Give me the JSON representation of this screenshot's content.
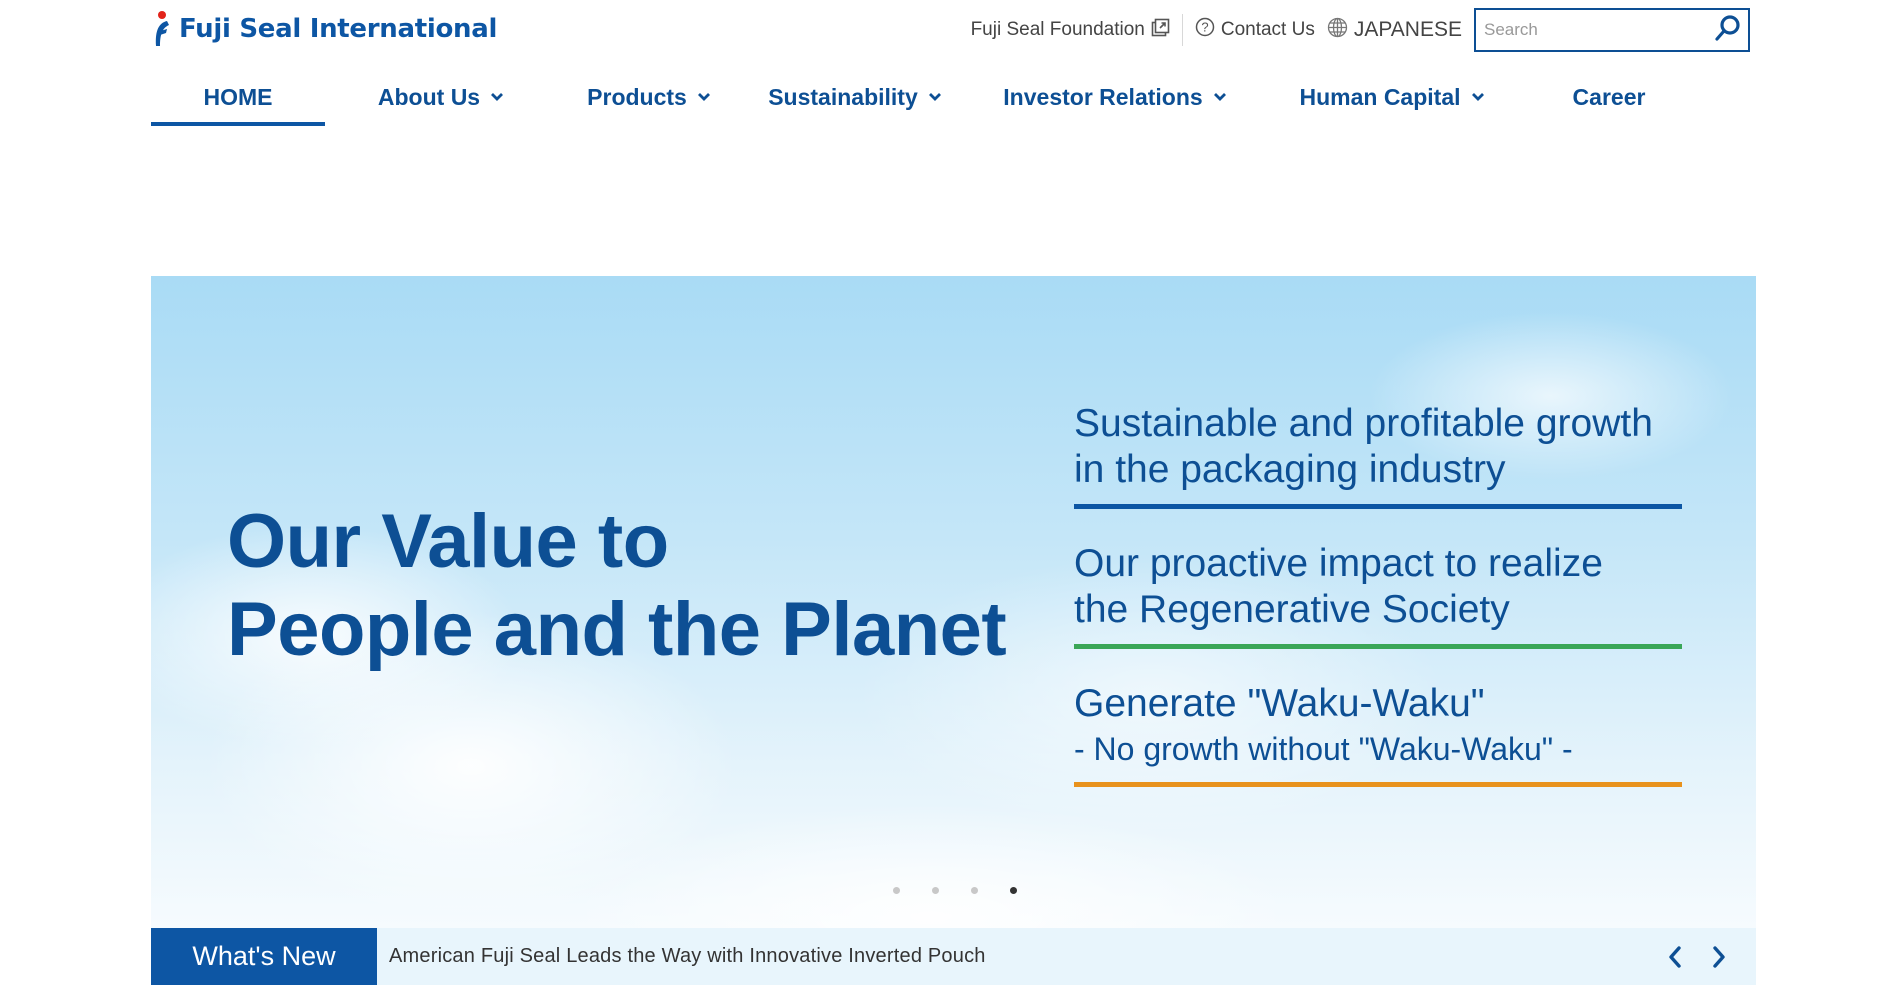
{
  "header": {
    "logo_text": "Fuji Seal International",
    "utility": {
      "foundation_label": "Fuji Seal Foundation",
      "contact_label": "Contact Us",
      "language_label": "JAPANESE",
      "search_placeholder": "Search"
    }
  },
  "nav": {
    "items": [
      {
        "label": "HOME"
      },
      {
        "label": "About Us"
      },
      {
        "label": "Products"
      },
      {
        "label": "Sustainability"
      },
      {
        "label": "Investor Relations"
      },
      {
        "label": "Human Capital"
      },
      {
        "label": "Career"
      }
    ]
  },
  "hero": {
    "heading_line1": "Our Value to",
    "heading_line2": "People and the Planet",
    "values": [
      {
        "line1": "Sustainable and profitable growth",
        "line2": "in the packaging industry",
        "color": "#0d56a4"
      },
      {
        "line1": "Our proactive impact to realize",
        "line2": "the Regenerative Society",
        "color": "#3aa657"
      },
      {
        "line1": "Generate \"Waku-Waku\"",
        "line2": "- No growth without \"Waku-Waku\" -",
        "color": "#e8921d"
      }
    ],
    "slides": {
      "count": 4,
      "active": 4
    }
  },
  "whats_new": {
    "label": "What's New",
    "headline": "American Fuji Seal Leads the Way with Innovative Inverted Pouch"
  },
  "colors": {
    "brand": "#0d56a4",
    "logo_red": "#e2231a",
    "nav_text": "#0d4f94"
  },
  "icons": {
    "foundation": "external-link-icon",
    "contact": "question-circle-icon",
    "language": "globe-icon",
    "search": "search-icon"
  }
}
